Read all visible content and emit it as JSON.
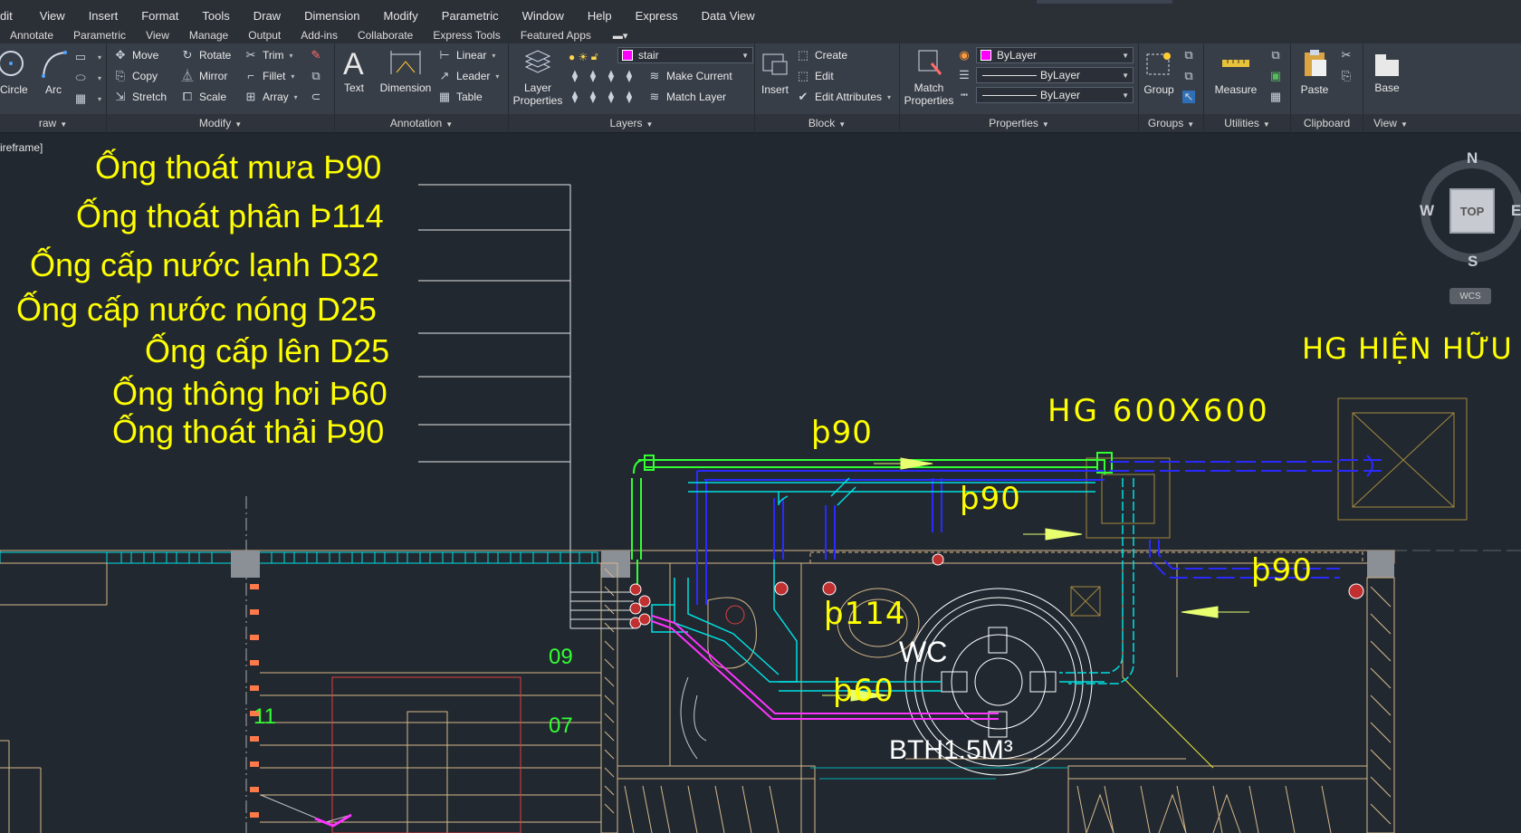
{
  "menubar": {
    "items": [
      "dit",
      "View",
      "Insert",
      "Format",
      "Tools",
      "Draw",
      "Dimension",
      "Modify",
      "Parametric",
      "Window",
      "Help",
      "Express",
      "Data View"
    ]
  },
  "tabs": {
    "items": [
      "Annotate",
      "Parametric",
      "View",
      "Manage",
      "Output",
      "Add-ins",
      "Collaborate",
      "Express Tools",
      "Featured Apps"
    ]
  },
  "ribbon": {
    "draw": {
      "circle": "Circle",
      "arc": "Arc",
      "title": "raw"
    },
    "modify": {
      "move": "Move",
      "rotate": "Rotate",
      "trim": "Trim",
      "copy": "Copy",
      "mirror": "Mirror",
      "fillet": "Fillet",
      "stretch": "Stretch",
      "scale": "Scale",
      "array": "Array",
      "title": "Modify"
    },
    "annotation": {
      "text": "Text",
      "dimension": "Dimension",
      "linear": "Linear",
      "leader": "Leader",
      "table": "Table",
      "title": "Annotation"
    },
    "layers": {
      "layer_properties_1": "Layer",
      "layer_properties_2": "Properties",
      "current_layer": "stair",
      "make_current": "Make Current",
      "match_layer": "Match Layer",
      "title": "Layers"
    },
    "block": {
      "insert": "Insert",
      "create": "Create",
      "edit": "Edit",
      "edit_attributes": "Edit Attributes",
      "title": "Block"
    },
    "properties": {
      "match_1": "Match",
      "match_2": "Properties",
      "color": "ByLayer",
      "linetype": "ByLayer",
      "lineweight": "ByLayer",
      "title": "Properties"
    },
    "groups": {
      "group": "Group",
      "title": "Groups"
    },
    "utilities": {
      "measure": "Measure",
      "title": "Utilities"
    },
    "clipboard": {
      "paste": "Paste",
      "title": "Clipboard"
    },
    "view": {
      "base": "Base",
      "title": "View"
    }
  },
  "viewport": {
    "label": "ireframe]"
  },
  "legend": {
    "items": [
      "Ống thoát mưa Þ90",
      "Ống thoát phân Þ114",
      "Ống cấp nước lạnh D32",
      "Ống cấp nước nóng D25",
      "Ống cấp lên D25",
      "Ống thông hơi Þ60",
      "Ống thoát thải Þ90"
    ]
  },
  "drawing_labels": {
    "hg_existing": "HG HIỆN HỮU",
    "hg_size": "HG 600X600",
    "p90_top": "þ90",
    "p90_mid": "þ90",
    "p90_right": "þ90",
    "p114": "þ114",
    "p60": "þ60",
    "wc": "WC",
    "tank": "BTH1.5M³",
    "num_09": "09",
    "num_07": "07",
    "num_11": "11"
  },
  "viewcube": {
    "n": "N",
    "s": "S",
    "w": "W",
    "e": "E",
    "top": "TOP",
    "wcs": "WCS"
  },
  "colors": {
    "background": "#212830",
    "annotation": "#ffff00",
    "pipe_green": "#33ff33",
    "pipe_blue": "#2222ff",
    "pipe_cyan": "#00e0e0",
    "pipe_magenta": "#ff33ff",
    "wall_tan": "#d6b98a"
  }
}
